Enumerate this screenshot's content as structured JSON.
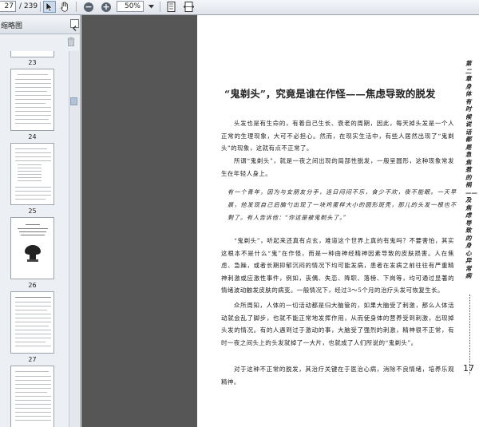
{
  "toolbar": {
    "current_page": "27",
    "total_pages": "/ 239",
    "zoom": "50%"
  },
  "panel": {
    "title": "缩略图",
    "thumb_labels": [
      "23",
      "24",
      "25",
      "26",
      "27"
    ]
  },
  "document": {
    "heading": "“鬼剃头”，究竟是谁在作怪——焦虑导致的脱发",
    "paragraphs": [
      "头发也是有生命的，有着自己生长、衰老的周期，因此，每天掉头发是一个人正常的生理现象，大可不必担心。然而，在现实生活中，有些人居然出现了“鬼剃头”的现象，这就有点不正常了。",
      "所谓“鬼剃头”，就是一夜之间出现的局部性脱发，一般呈圆形，这种现象常发生在年轻人身上。"
    ],
    "story": "有一个青年，因为与女朋友分手，连日闷闷不乐，食少不欢，夜不能眠。一天早晨，他发现自己后脑勺出现了一块鸡蛋样大小的圆形斑秃，那儿的头发一根也不剩了。有人告诉他：“你这是被鬼剃头了。”",
    "paragraphs2": [
      "“鬼剃头”，听起来还真有点玄，难道这个世界上真的有鬼吗？不要害怕，其实这根本不是什么“鬼”在作怪，而是一种由神经精神因素导致的皮肤损害。人在焦虑、急躁，或者长期抑郁沉闷的情况下均可能发病，患者在发病之前往往有严重精神刺激或应激性事件，例如，丧偶、失恋、降职、落榜、下岗等，均可通过显著的情绪波动触发皮肤的病变。一般情况下，经过3～5个月的治疗头发可恢复生长。",
      "众所周知，人体的一切活动都是归大脑管的，如果大脑受了刺激，那么人体活动就会乱了脚步，也就不能正常地发挥作用，从而使身体的营养受到刺激，出现掉头发的情况。有的人遇到过于激动的事，大脑受了强烈的刺激，精神很不正常，有时一夜之间头上的头发就掉了一大片，也就成了人们所说的“鬼剃头”。",
      "对于这种不正常的脱发，其治疗关键在于医治心病，消除不良情绪，培养乐观精神。"
    ],
    "sidebar_text": "第二章 身体有时候说话 都是急焦惹的祸——及焦虑导致的身心异常病",
    "page_number": "17"
  }
}
